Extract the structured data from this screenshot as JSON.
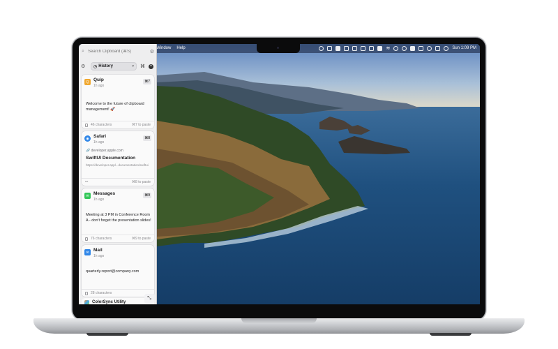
{
  "menubar": {
    "menus": [
      "Window",
      "Help"
    ],
    "clock": "Sun 1:09 PM"
  },
  "panel": {
    "search": {
      "placeholder": "Search Clipboard (⌘S)"
    },
    "filter_label": "History",
    "cards": [
      {
        "app": "Quip",
        "time": "1h ago",
        "shortcut": "⌘7",
        "icon_color": "#f0a830",
        "content": "Welcome to the future of clipboard management! 🚀",
        "meta": "46 characters",
        "hint": "⌘7 to paste"
      },
      {
        "app": "Safari",
        "time": "1h ago",
        "shortcut": "⌘8",
        "icon_color": "#2f86e8",
        "link_domain": "developer.apple.com",
        "link_title": "SwiftUI Documentation",
        "link_url": "https://developer.appl...documentation/swiftui",
        "hint": "⌘8 to paste"
      },
      {
        "app": "Messages",
        "time": "1h ago",
        "shortcut": "⌘9",
        "icon_color": "#34c759",
        "content": "Meeting at 3 PM in Conference Room A - don't forget the presentation slides!",
        "meta": "76 characters",
        "hint": "⌘9 to paste"
      },
      {
        "app": "Mail",
        "time": "1h ago",
        "icon_color": "#2f86e8",
        "content": "quarterly.report@company.com",
        "meta": "28 characters"
      }
    ],
    "peek_app": "ColorSync Utility"
  },
  "icons": {
    "search": "search-icon",
    "settings": "gear-icon",
    "history": "clock-icon",
    "command": "command-icon",
    "add": "plus-icon",
    "expand": "expand-icon"
  }
}
